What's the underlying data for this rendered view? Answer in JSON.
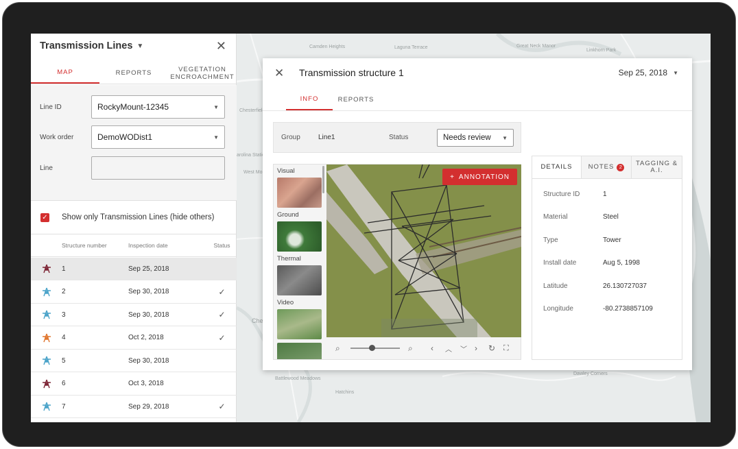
{
  "colors": {
    "accent": "#d32f2f",
    "tower_teal": "#4aa3c9",
    "tower_maroon": "#7d2636",
    "tower_orange": "#e0762f"
  },
  "map": {
    "labels": [
      "Camden Heights",
      "Great Neck Manor",
      "Laguna Terrace",
      "Linkhorn Park",
      "Chesterfield",
      "West Mo",
      "arolina Station",
      "Che",
      "Battlewood Meadows",
      "Hatchins",
      "Dawley Corners"
    ]
  },
  "panel": {
    "title": "Transmission Lines",
    "tabs": [
      {
        "label": "MAP"
      },
      {
        "label": "REPORTS"
      },
      {
        "label": "VEGETATION ENCROACHMENT"
      }
    ],
    "fields": [
      {
        "label": "Line ID",
        "value": "RockyMount-12345"
      },
      {
        "label": "Work order",
        "value": "DemoWODist1"
      },
      {
        "label": "Line",
        "value": ""
      }
    ],
    "checkbox_label": "Show only Transmission Lines (hide others)",
    "table_headers": {
      "structure": "Structure number",
      "date": "Inspection date",
      "status": "Status"
    },
    "rows": [
      {
        "num": "1",
        "date": "Sep 25, 2018",
        "status": "",
        "icon_color": "#7d2636"
      },
      {
        "num": "2",
        "date": "Sep 30, 2018",
        "status": "✓",
        "icon_color": "#4aa3c9"
      },
      {
        "num": "3",
        "date": "Sep 30, 2018",
        "status": "✓",
        "icon_color": "#4aa3c9"
      },
      {
        "num": "4",
        "date": "Oct 2, 2018",
        "status": "✓",
        "icon_color": "#e0762f"
      },
      {
        "num": "5",
        "date": "Sep 30, 2018",
        "status": "",
        "icon_color": "#4aa3c9"
      },
      {
        "num": "6",
        "date": "Oct 3, 2018",
        "status": "",
        "icon_color": "#7d2636"
      },
      {
        "num": "7",
        "date": "Sep 29, 2018",
        "status": "✓",
        "icon_color": "#4aa3c9"
      }
    ]
  },
  "card": {
    "title": "Transmission structure 1",
    "date": "Sep 25, 2018",
    "tabs": [
      {
        "label": "INFO"
      },
      {
        "label": "REPORTS"
      }
    ],
    "group_label": "Group",
    "group_value": "Line1",
    "status_label": "Status",
    "status_value": "Needs review",
    "thumb_captions": [
      "Visual",
      "Ground",
      "Thermal",
      "Video"
    ],
    "annotation_label": "ANNOTATION",
    "detail_tabs": {
      "details": "DETAILS",
      "notes": "NOTES",
      "notes_count": "2",
      "tagging": "TAGGING & A.I."
    },
    "details": [
      {
        "key": "Structure ID",
        "value": "1"
      },
      {
        "key": "Material",
        "value": "Steel"
      },
      {
        "key": "Type",
        "value": "Tower"
      },
      {
        "key": "Install date",
        "value": "Aug 5, 1998"
      },
      {
        "key": "Latitude",
        "value": "26.130727037"
      },
      {
        "key": "Longitude",
        "value": "-80.2738857109"
      }
    ]
  }
}
